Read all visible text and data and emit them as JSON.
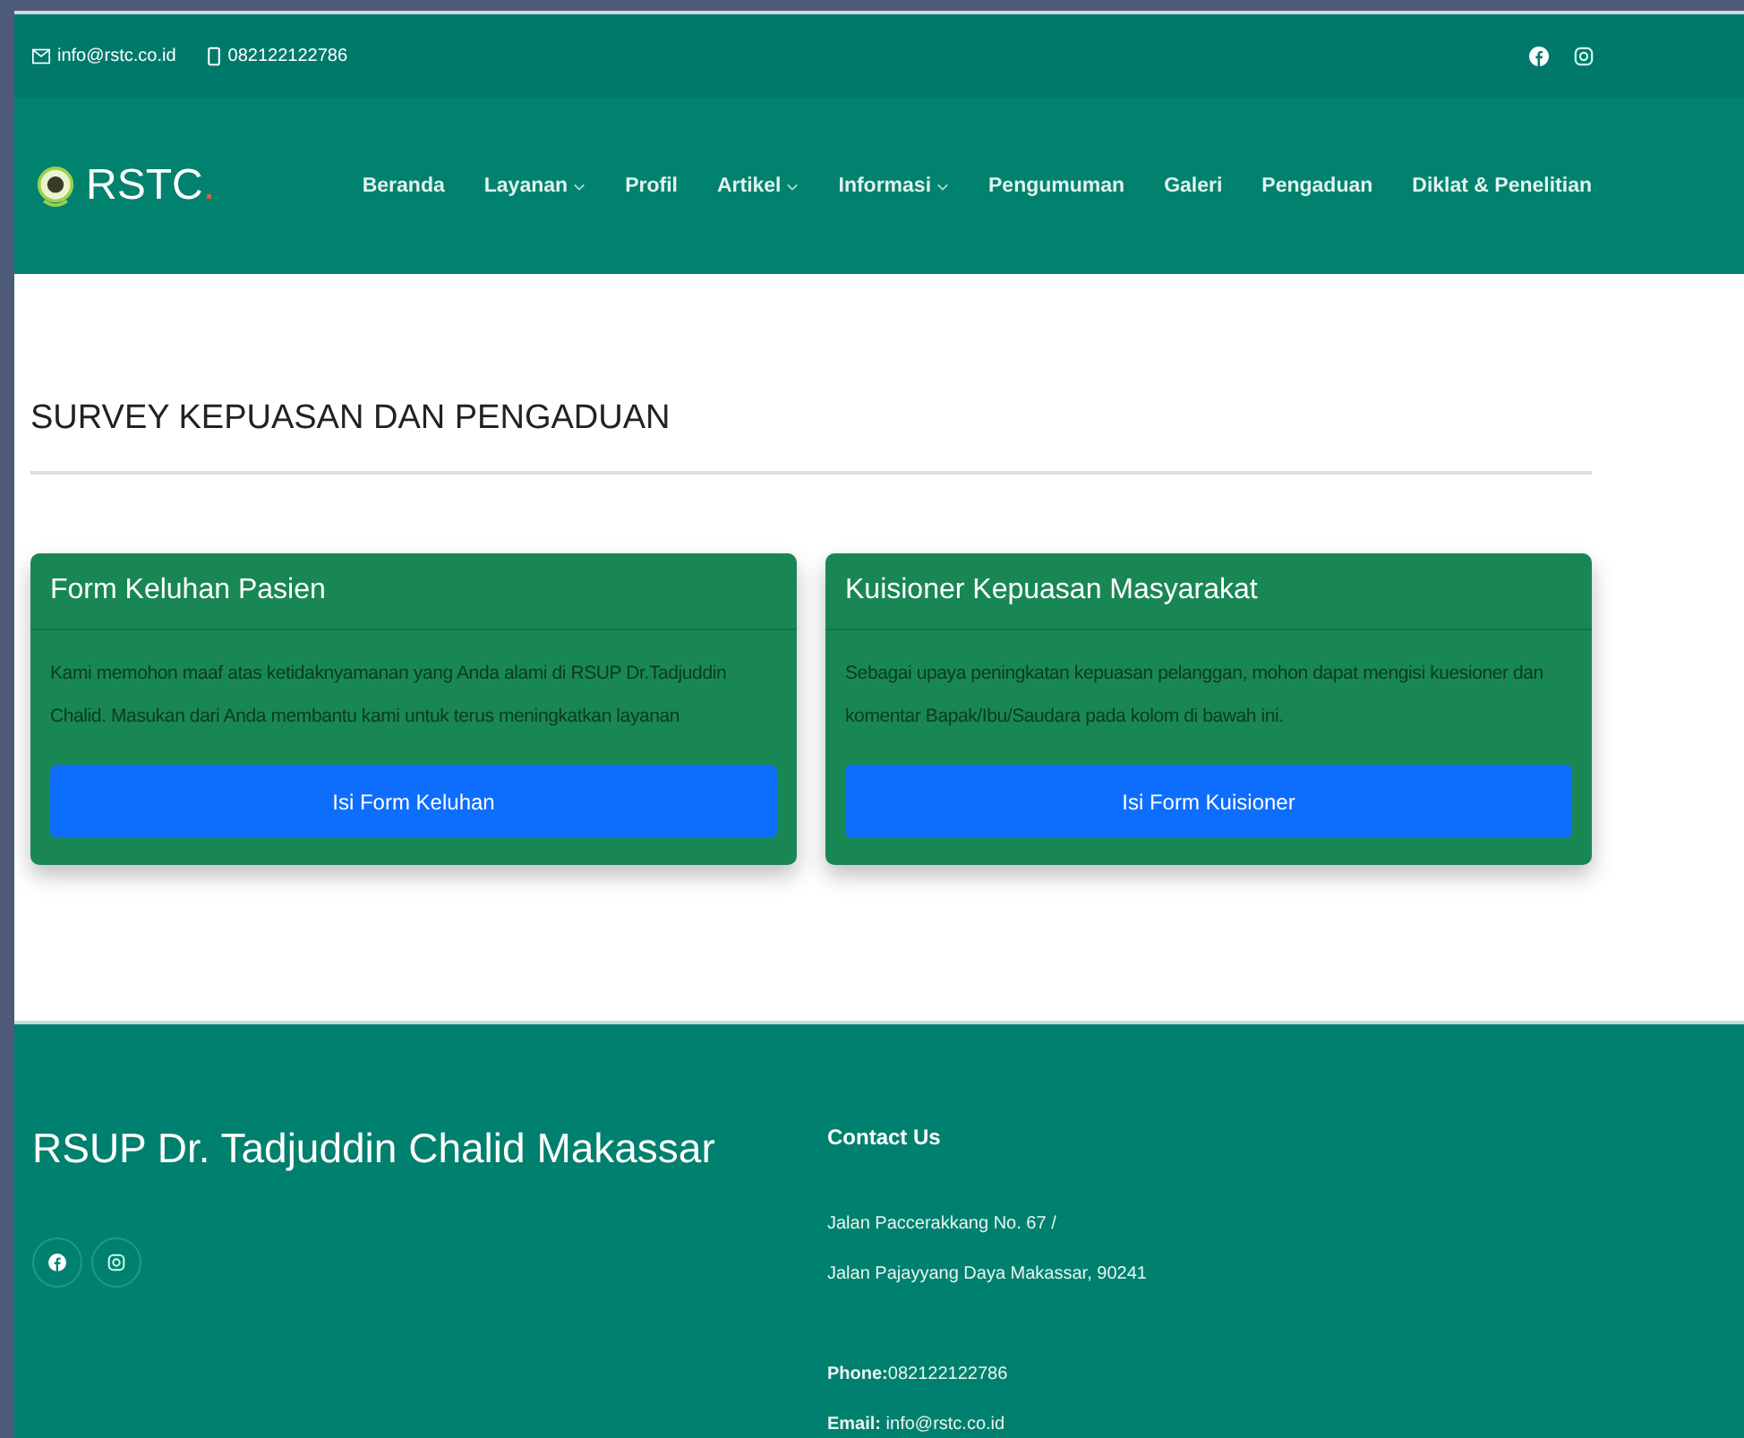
{
  "topbar": {
    "email": "info@rstc.co.id",
    "phone": "082122122786"
  },
  "brand": {
    "name": "RSTC",
    "dot": "."
  },
  "nav": [
    {
      "label": "Beranda",
      "dropdown": false
    },
    {
      "label": "Layanan",
      "dropdown": true
    },
    {
      "label": "Profil",
      "dropdown": false
    },
    {
      "label": "Artikel",
      "dropdown": true
    },
    {
      "label": "Informasi",
      "dropdown": true
    },
    {
      "label": "Pengumuman",
      "dropdown": false
    },
    {
      "label": "Galeri",
      "dropdown": false
    },
    {
      "label": "Pengaduan",
      "dropdown": false
    },
    {
      "label": "Diklat & Penelitian",
      "dropdown": false
    }
  ],
  "section_title": "SURVEY KEPUASAN DAN PENGADUAN",
  "cards": [
    {
      "title": "Form Keluhan Pasien",
      "text": "Kami memohon maaf atas ketidaknyamanan yang Anda alami di RSUP Dr.Tadjuddin Chalid. Masukan dari Anda membantu kami untuk terus meningkatkan layanan",
      "button": "Isi Form Keluhan"
    },
    {
      "title": "Kuisioner Kepuasan Masyarakat",
      "text": "Sebagai upaya peningkatan kepuasan pelanggan, mohon dapat mengisi kuesioner dan komentar Bapak/Ibu/Saudara pada kolom di bawah ini.",
      "button": "Isi Form Kuisioner"
    }
  ],
  "footer": {
    "title": "RSUP Dr. Tadjuddin Chalid Makassar",
    "contact_heading": "Contact Us",
    "address": [
      "Jalan Paccerakkang No. 67 /",
      "Jalan Pajayyang Daya Makassar, 90241"
    ],
    "phone": "**Phone:**082122122786",
    "email": "**Email:** info@rstc.co.id"
  }
}
